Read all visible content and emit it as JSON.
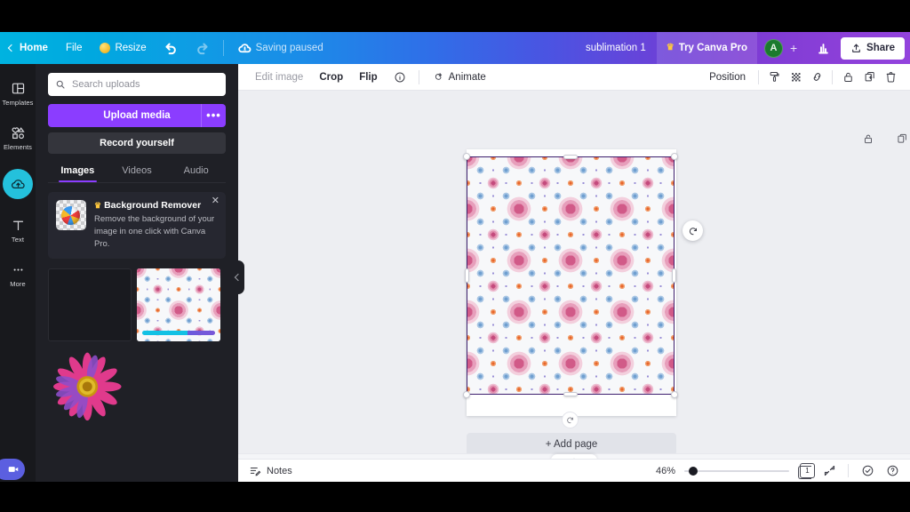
{
  "header": {
    "back_icon": "chevron-left-icon",
    "home_label": "Home",
    "file_label": "File",
    "resize_label": "Resize",
    "resize_icon": "crown-coin-icon",
    "undo_icon": "undo-arrow-icon",
    "redo_icon": "redo-arrow-icon",
    "cloud_icon": "cloud-alert-icon",
    "saving_status": "Saving paused",
    "doc_title": "sublimation 1",
    "pro_label": "Try Canva Pro",
    "pro_icon": "crown-icon",
    "avatar_initial": "A",
    "add_collaborator_label": "+",
    "insights_icon": "bar-chart-icon",
    "share_label": "Share",
    "share_icon": "share-upload-icon",
    "gradient_start": "#00b3e0",
    "gradient_end": "#9343dd"
  },
  "rail": {
    "items": [
      {
        "label": "Templates",
        "icon": "templates-grid-icon",
        "active": false
      },
      {
        "label": "Elements",
        "icon": "elements-shapes-icon",
        "active": false
      },
      {
        "label": "",
        "icon": "uploads-cloud-icon",
        "active": true
      },
      {
        "label": "Text",
        "icon": "text-t-icon",
        "active": false
      },
      {
        "label": "More",
        "icon": "more-dots-icon",
        "active": false
      }
    ],
    "active_color": "#24c1dc"
  },
  "panel": {
    "search": {
      "placeholder": "Search uploads",
      "value": "",
      "icon": "search-icon"
    },
    "upload_button": {
      "label": "Upload media",
      "more_label": "•••",
      "color": "#8b3dff"
    },
    "record_button": {
      "label": "Record yourself"
    },
    "tabs": [
      {
        "label": "Images",
        "active": true
      },
      {
        "label": "Videos",
        "active": false
      },
      {
        "label": "Audio",
        "active": false
      }
    ],
    "promo": {
      "title": "Background Remover",
      "crown_icon": "crown-icon",
      "description": "Remove the background of your image in one click with Canva Pro.",
      "close_icon": "close-icon",
      "thumb_icon": "beachball-transparency-icon"
    },
    "uploads": [
      {
        "name": "empty-placeholder",
        "type": "placeholder"
      },
      {
        "name": "mandala-pattern-upload",
        "type": "pattern",
        "uploading": true
      },
      {
        "name": "pink-flower-upload",
        "type": "flower"
      }
    ],
    "collapse_icon": "chevron-left-icon"
  },
  "context_bar": {
    "edit_image_label": "Edit image",
    "crop_label": "Crop",
    "flip_label": "Flip",
    "info_icon": "info-circle-icon",
    "animate_label": "Animate",
    "animate_icon": "animate-swirl-icon",
    "position_label": "Position",
    "tools": [
      {
        "icon": "paint-roller-icon"
      },
      {
        "icon": "transparency-checker-icon"
      },
      {
        "icon": "link-icon"
      },
      {
        "icon": "lock-icon"
      },
      {
        "icon": "duplicate-icon"
      },
      {
        "icon": "trash-icon"
      }
    ]
  },
  "canvas": {
    "page_tools": [
      {
        "icon": "lock-icon"
      },
      {
        "icon": "duplicate-icon"
      },
      {
        "icon": "add-page-icon"
      }
    ],
    "rotate_icon": "rotate-icon",
    "page_rotate_icon": "rotate-page-icon",
    "add_page_label": "+ Add page",
    "cursor_icon": "mouse-cursor-icon",
    "selection_border_color": "#3d1f6e"
  },
  "status_bar": {
    "notes_label": "Notes",
    "notes_icon": "notes-icon",
    "zoom_value": "46%",
    "page_count": "1",
    "expand_icon": "fullscreen-expand-icon",
    "check_icon": "check-circle-icon",
    "help_icon": "help-circle-icon"
  },
  "taskbar": {
    "video_icon": "video-camera-icon"
  }
}
